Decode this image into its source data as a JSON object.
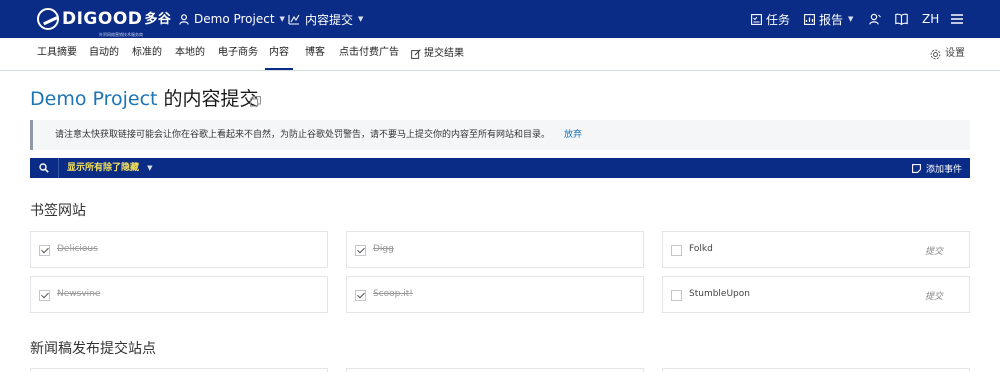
{
  "brand": {
    "name": "DIGOOD",
    "name_cn": "多谷",
    "tagline": "外贸网络营销技术服务商"
  },
  "topbar": {
    "project": "Demo Project",
    "tool": "内容提交",
    "tasks": "任务",
    "reports": "报告",
    "lang": "ZH"
  },
  "subnav": {
    "items": [
      "工具摘要",
      "自动的",
      "标准的",
      "本地的",
      "电子商务",
      "内容",
      "博客",
      "点击付费广告",
      "提交结果"
    ],
    "active_index": 5,
    "settings": "设置"
  },
  "page": {
    "project": "Demo Project",
    "title_suffix": " 的内容提交"
  },
  "notice": {
    "text": "请注意太快获取链接可能会让你在谷歌上看起来不自然，为防止谷歌处罚警告，请不要马上提交你的内容至所有网站和目录。",
    "dismiss": "放弃"
  },
  "filterbar": {
    "filter_label": "显示所有除了隐藏",
    "add_event": "添加事件"
  },
  "sections": [
    {
      "title": "书签网站",
      "sites": [
        {
          "name": "Delicious",
          "checked": true,
          "action": ""
        },
        {
          "name": "Digg",
          "checked": true,
          "action": ""
        },
        {
          "name": "Folkd",
          "checked": false,
          "action": "提交"
        },
        {
          "name": "Newsvine",
          "checked": true,
          "action": ""
        },
        {
          "name": "Scoop.it!",
          "checked": true,
          "action": ""
        },
        {
          "name": "StumbleUpon",
          "checked": false,
          "action": "提交"
        }
      ]
    },
    {
      "title": "新闻稿发布提交站点",
      "sites": []
    }
  ]
}
